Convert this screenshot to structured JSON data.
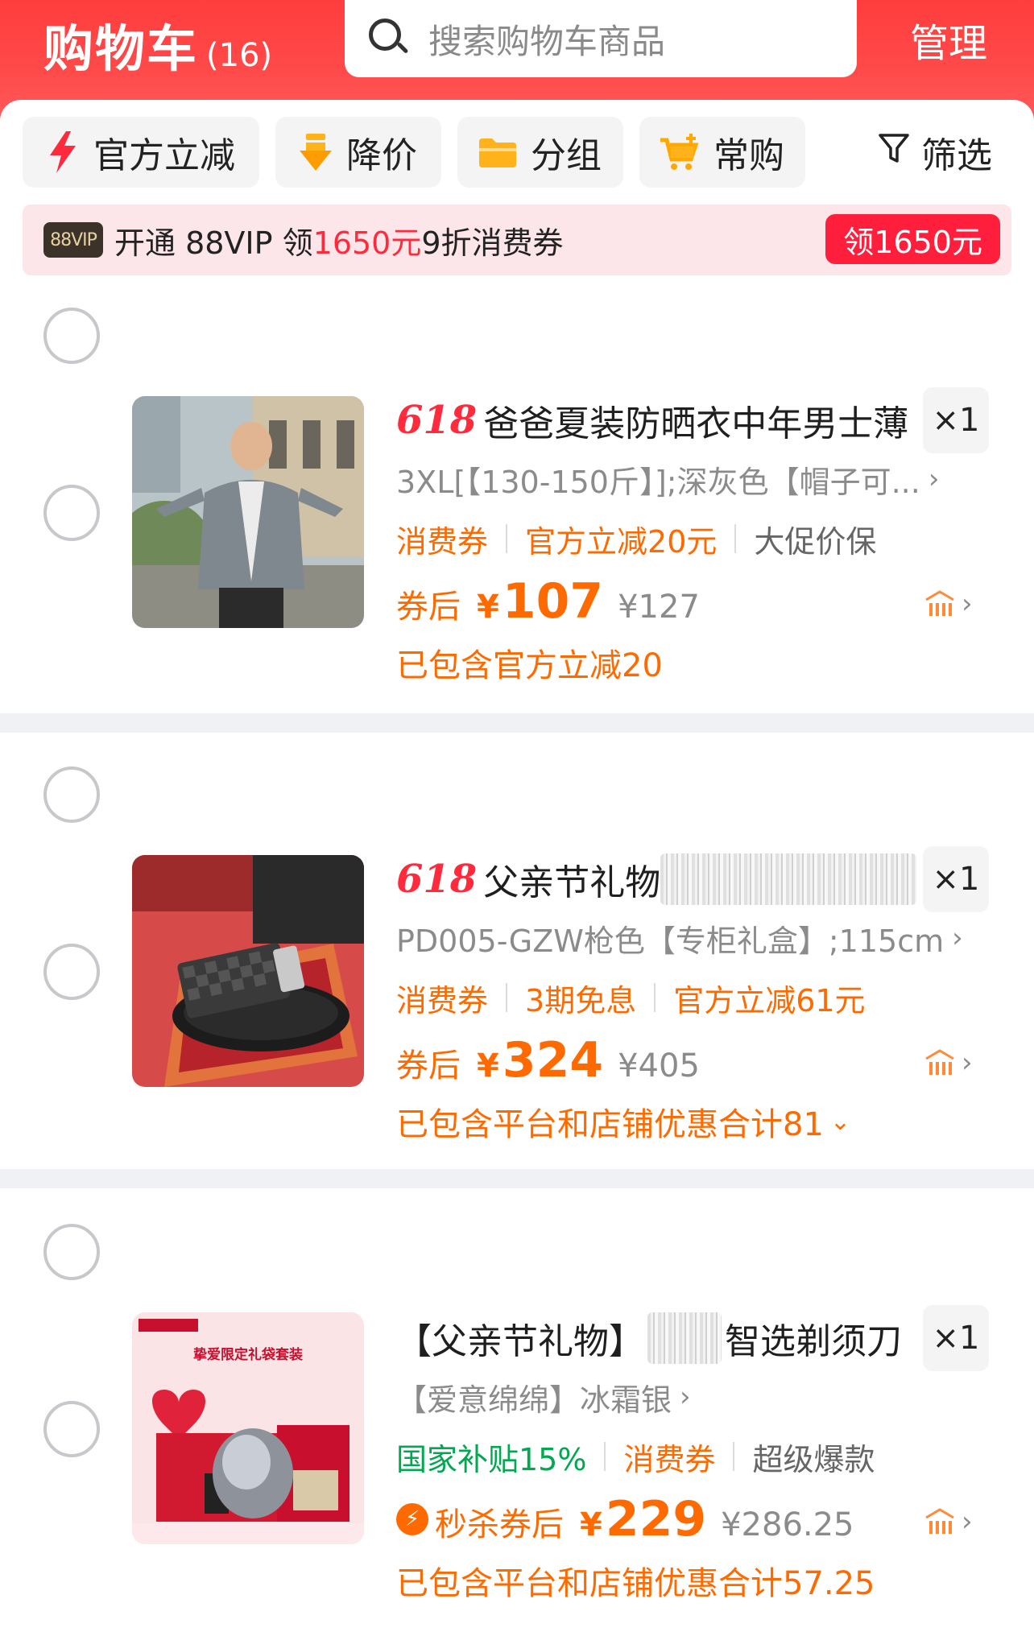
{
  "header": {
    "title": "购物车",
    "count": "(16)",
    "search_placeholder": "搜索购物车商品",
    "manage_label": "管理"
  },
  "filters": [
    {
      "label": "官方立减",
      "icon": "lightning-icon"
    },
    {
      "label": "降价",
      "icon": "price-drop-icon"
    },
    {
      "label": "分组",
      "icon": "folder-icon"
    },
    {
      "label": "常购",
      "icon": "cart-plus-icon"
    }
  ],
  "filter_button": "筛选",
  "vip_banner": {
    "badge": "88VIP",
    "text_prefix": "开通 88VIP 领",
    "amount": "1650元",
    "text_suffix": "9折消费券",
    "cta": "领1650元"
  },
  "items": [
    {
      "tag": "618",
      "title": "爸爸夏装防晒衣中年男士薄",
      "quantity": "×1",
      "sku": "3XL[【130-150斤】];深灰色【帽子可...",
      "promos": [
        "消费券",
        "官方立减20元",
        "大促价保"
      ],
      "price_label": "券后",
      "currency": "¥",
      "price": "107",
      "original_price": "¥127",
      "included_note": "已包含官方立减20"
    },
    {
      "tag": "618",
      "title": "父亲节礼物",
      "quantity": "×1",
      "sku": "PD005-GZW枪色【专柜礼盒】;115cm",
      "promos": [
        "消费券",
        "3期免息",
        "官方立减61元"
      ],
      "price_label": "券后",
      "currency": "¥",
      "price": "324",
      "original_price": "¥405",
      "included_note": "已包含平台和店铺优惠合计81"
    },
    {
      "title_prefix": "【父亲节礼物】",
      "title_suffix": "智选剃须刀",
      "quantity": "×1",
      "sku": "【爱意绵绵】冰霜银",
      "promos": [
        "国家补贴15%",
        "消费券",
        "超级爆款"
      ],
      "price_label": "秒杀券后",
      "currency": "¥",
      "price": "229",
      "original_price": "¥286.25",
      "included_note": "已包含平台和店铺优惠合计57.25",
      "thumb_caption": "挚爱限定礼袋套装"
    }
  ],
  "colors": {
    "header_red": "#ff3d3d",
    "accent_orange": "#ff6a00",
    "vip_red": "#ff1f3d",
    "subsidy_green": "#00a84f"
  }
}
